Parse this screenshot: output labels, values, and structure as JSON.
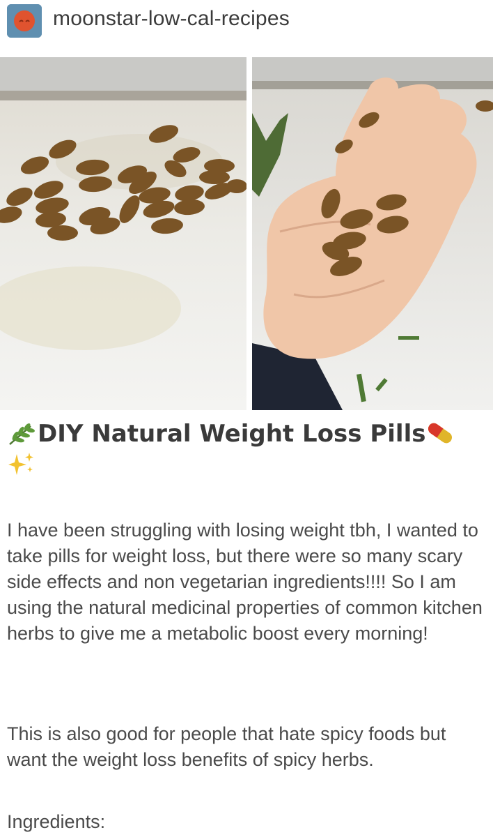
{
  "post": {
    "blog_name": "moonstar-low-cal-recipes",
    "title": "DIY Natural Weight Loss Pills",
    "title_icons": [
      "herb-icon",
      "pill-icon",
      "sparkles-icon"
    ],
    "paragraphs": [
      "I have been struggling with losing weight tbh, I wanted to take pills for weight loss, but there were so many scary side effects and non vegetarian ingredients!!!! So I am using the natural medicinal properties of common kitchen herbs to give me a metabolic boost every morning!",
      "This is also good for people that hate spicy foods but want the weight loss benefits of spicy herbs.",
      "Ingredients:"
    ]
  },
  "colors": {
    "avatar_bg": "#5f8fb0",
    "avatar_face": "#e0532f",
    "pill_brown": "#7a5426",
    "text": "#4a4a4a"
  }
}
